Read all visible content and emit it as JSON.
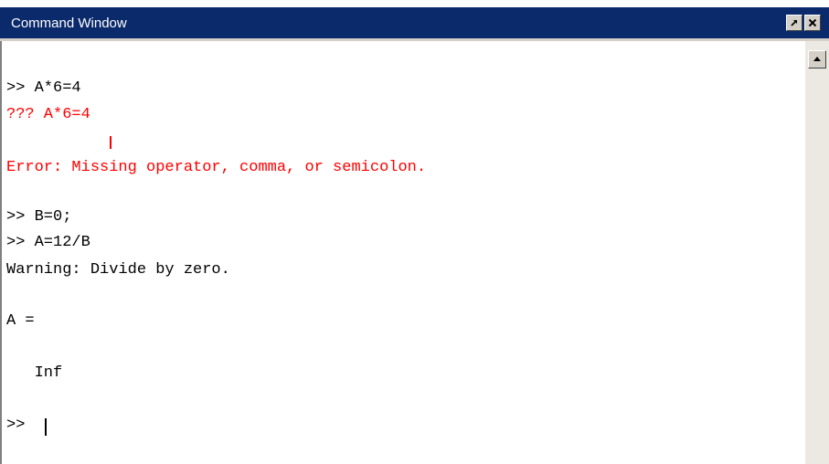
{
  "window": {
    "title": "Command Window"
  },
  "icons": {
    "undock": "undock-arrow-icon",
    "close": "close-x-icon",
    "scroll_up": "scroll-up-arrow-icon"
  },
  "colors": {
    "titlebar": "#0a2a6b",
    "error_text": "#ff0000",
    "normal_text": "#000000"
  },
  "console": {
    "lines": [
      {
        "text": ">> A*6=4",
        "kind": "input"
      },
      {
        "text": "??? A*6=4",
        "kind": "error"
      },
      {
        "text": "Error: Missing operator, comma, or semicolon.",
        "kind": "error"
      },
      {
        "text": ">> B=0;",
        "kind": "input"
      },
      {
        "text": ">> A=12/B",
        "kind": "input"
      },
      {
        "text": "Warning: Divide by zero.",
        "kind": "output"
      },
      {
        "text": "A =",
        "kind": "output"
      },
      {
        "text": "   Inf",
        "kind": "output"
      },
      {
        "text": ">> ",
        "kind": "prompt"
      }
    ]
  }
}
